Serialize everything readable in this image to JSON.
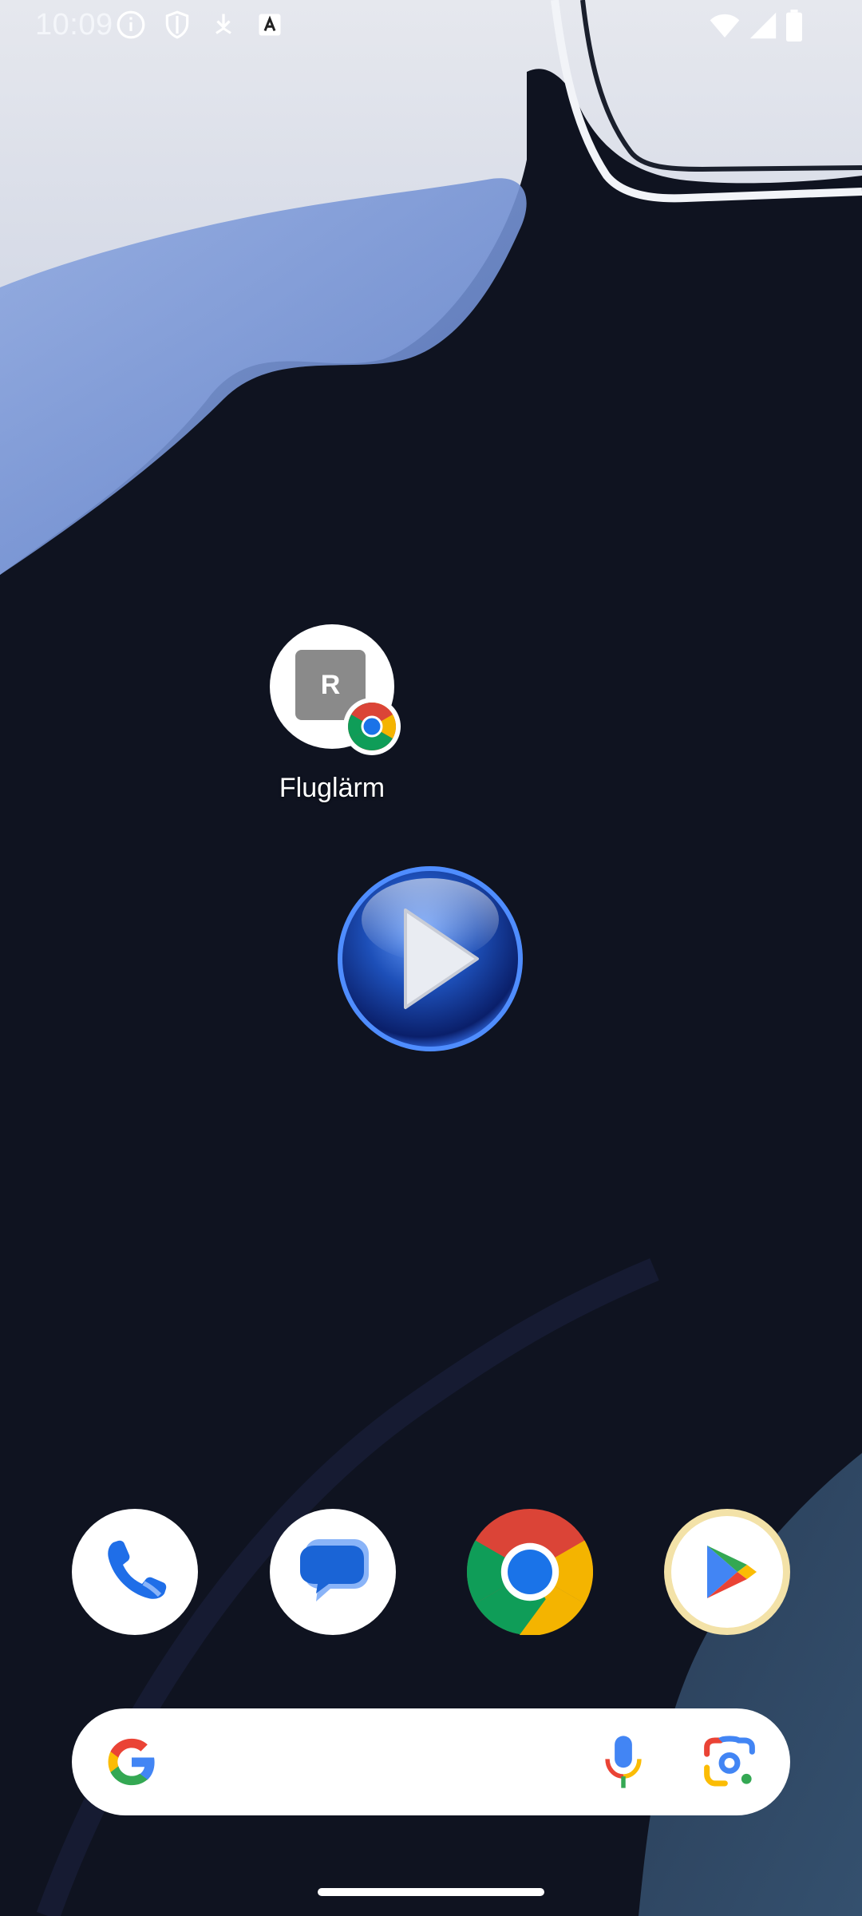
{
  "status_bar": {
    "time": "10:09",
    "left_icons": [
      "info-icon",
      "shield-icon",
      "download-arrow-icon",
      "keyboard-a-icon"
    ],
    "right_icons": [
      "wifi-icon",
      "cellular-signal-icon",
      "battery-icon"
    ]
  },
  "home": {
    "web_shortcut": {
      "badge_letter": "R",
      "label": "Fluglärm",
      "badge_icon": "chrome-icon"
    },
    "floating_player": {
      "icon": "play-icon",
      "accent": "#1e56c8"
    }
  },
  "dock": {
    "apps": [
      {
        "name": "phone-icon",
        "color": "#1f6ee8"
      },
      {
        "name": "messages-icon",
        "color": "#1a64d6"
      },
      {
        "name": "chrome-icon",
        "color": "#1a73e8"
      },
      {
        "name": "play-store-icon",
        "color": "#f4b400"
      }
    ]
  },
  "search": {
    "icons": [
      "google-g-icon",
      "microphone-icon",
      "google-lens-icon"
    ]
  },
  "colors": {
    "wallpaper_dark": "#0f1320",
    "wallpaper_light": "#dfe3ee",
    "wallpaper_blue": "#7f9ddc"
  }
}
